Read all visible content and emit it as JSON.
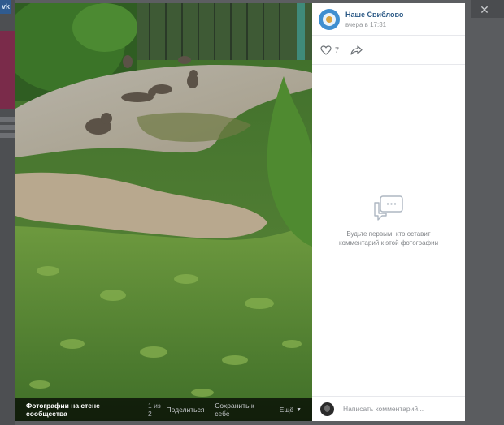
{
  "page_background": {
    "logo_text": "vk"
  },
  "photo": {
    "description_icon": "photo-of-kittens-on-path",
    "caption": "Фотографии на стене сообщества",
    "counter": "1 из 2",
    "actions": {
      "share_label": "Поделиться",
      "save_label": "Сохранить к себе",
      "more_label": "Ещё"
    }
  },
  "side_panel": {
    "community_name": "Наше Свиблово",
    "post_time": "вчера в 17:31",
    "likes_count": "7",
    "empty_comments": "Будьте первым, кто оставит комментарий к этой фотографии",
    "comment_placeholder": "Написать комментарий..."
  },
  "colors": {
    "link_blue": "#2a5885",
    "panel_bg": "#ffffff",
    "overlay_bg": "#5c5e61"
  },
  "icons": {
    "like": "heart-icon",
    "share": "share-arrow-icon",
    "empty": "chat-bubbles-icon",
    "close": "close-icon"
  }
}
